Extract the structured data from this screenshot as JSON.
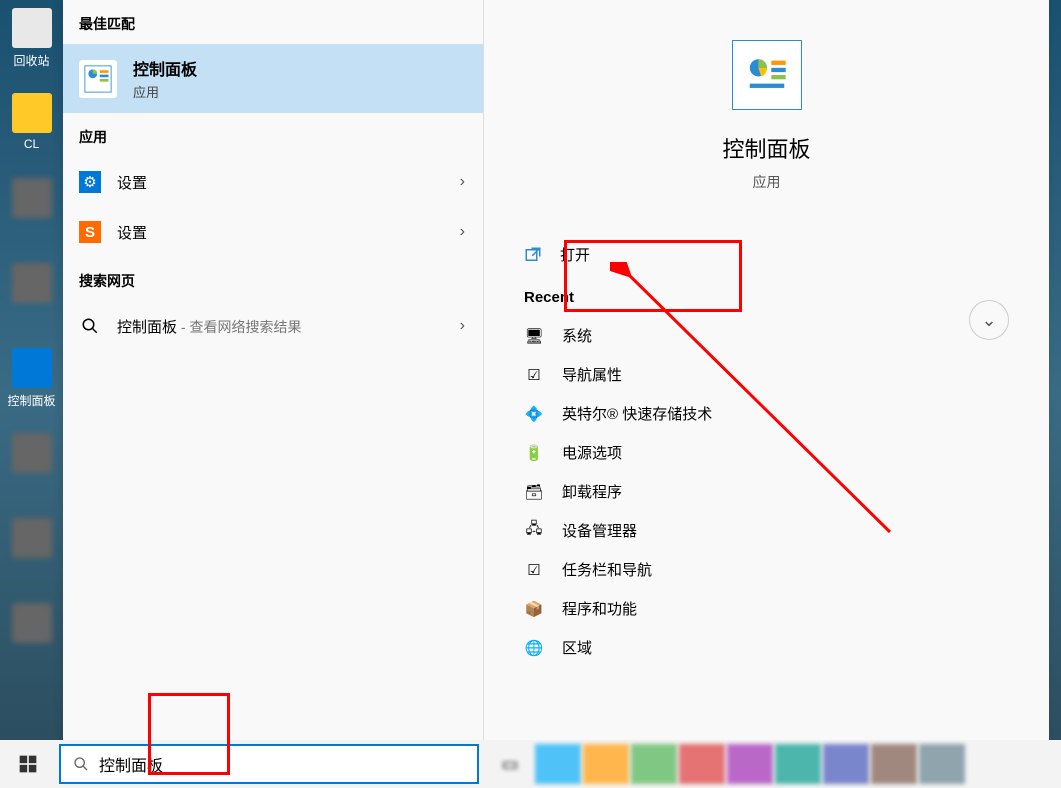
{
  "desktop_icons": [
    {
      "label": "回收站",
      "kind": "trash"
    },
    {
      "label": "CL",
      "kind": "folder"
    },
    {
      "label": "",
      "kind": "bl"
    },
    {
      "label": "",
      "kind": "bl"
    },
    {
      "label": "控制面板",
      "kind": "cp"
    }
  ],
  "panel": {
    "best_match_label": "最佳匹配",
    "best_match": {
      "title": "控制面板",
      "subtitle": "应用"
    },
    "apps_label": "应用",
    "app_items": [
      {
        "icon": "settings",
        "label": "设置",
        "hasChevron": true
      },
      {
        "icon": "sogou",
        "label": "设置",
        "hasChevron": true
      }
    ],
    "web_label": "搜索网页",
    "web_item": {
      "label": "控制面板",
      "suffix": " - 查看网络搜索结果",
      "hasChevron": true
    }
  },
  "details": {
    "title": "控制面板",
    "subtitle": "应用",
    "open_label": "打开",
    "recent_label": "Recent",
    "recent": [
      {
        "icon": "monitor",
        "label": "系统"
      },
      {
        "icon": "check",
        "label": "导航属性"
      },
      {
        "icon": "intel",
        "label": "英特尔® 快速存储技术"
      },
      {
        "icon": "power",
        "label": "电源选项"
      },
      {
        "icon": "uninstall",
        "label": "卸载程序"
      },
      {
        "icon": "device",
        "label": "设备管理器"
      },
      {
        "icon": "check",
        "label": "任务栏和导航"
      },
      {
        "icon": "program",
        "label": "程序和功能"
      },
      {
        "icon": "globe",
        "label": "区域"
      }
    ]
  },
  "search": {
    "value": "控制面板"
  },
  "icons": {
    "settings": "⚙",
    "sogou": "S",
    "search": "🔍",
    "monitor": "🖥",
    "check": "☑",
    "intel": "💠",
    "power": "🔋",
    "uninstall": "🗑",
    "device": "🖧",
    "program": "📦",
    "globe": "🌐"
  }
}
